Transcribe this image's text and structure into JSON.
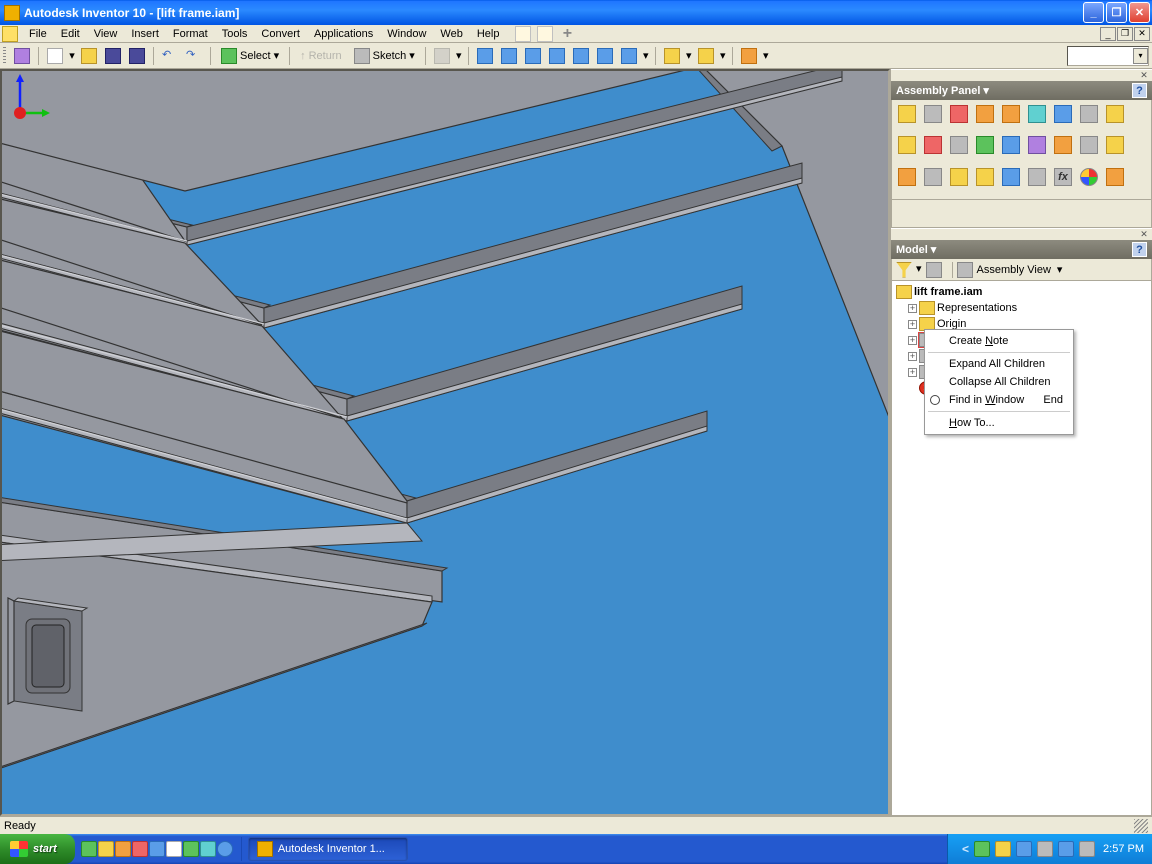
{
  "title": "Autodesk Inventor 10 - [lift frame.iam]",
  "menus": [
    "File",
    "Edit",
    "View",
    "Insert",
    "Format",
    "Tools",
    "Convert",
    "Applications",
    "Window",
    "Web",
    "Help"
  ],
  "toolbar": {
    "select_label": "Select",
    "return_label": "Return",
    "sketch_label": "Sketch"
  },
  "panels": {
    "assembly": {
      "title": "Assembly Panel"
    },
    "model": {
      "title": "Model",
      "view_label": "Assembly View",
      "root": "lift frame.iam",
      "tree": [
        "Representations",
        "Origin"
      ]
    }
  },
  "context_menu": {
    "items": [
      {
        "label": "Create Note",
        "u": 7
      },
      {
        "sep": true
      },
      {
        "label": "Expand All Children",
        "u": null
      },
      {
        "label": "Collapse All Children",
        "u": null
      },
      {
        "label": "Find in Window",
        "u": 8,
        "accel": "End",
        "icon": true
      },
      {
        "sep": true
      },
      {
        "label": "How To...",
        "u": 0
      }
    ]
  },
  "status": "Ready",
  "taskbar": {
    "start": "start",
    "task": "Autodesk Inventor 1...",
    "clock": "2:57 PM"
  }
}
